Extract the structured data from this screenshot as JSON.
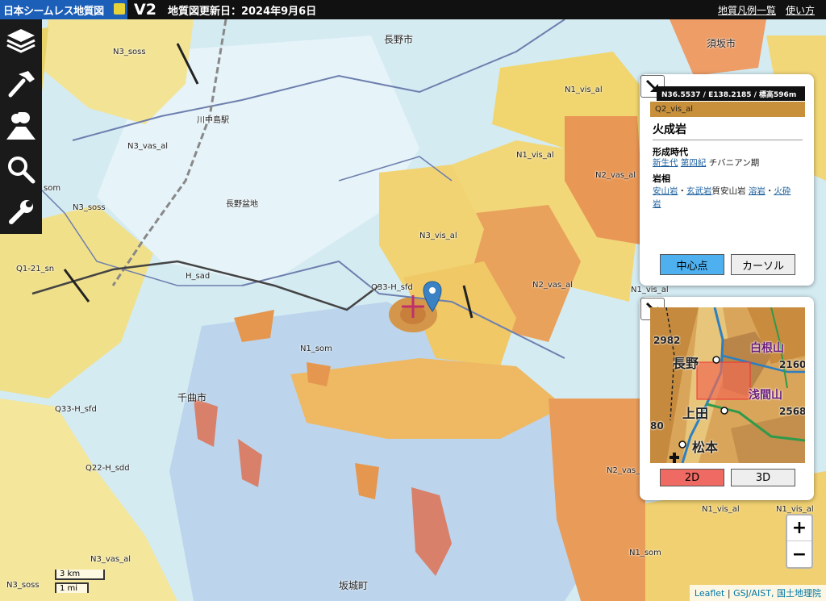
{
  "header": {
    "logo_text": "日本シームレス地質図",
    "version": "V2",
    "updated": "地質図更新日：2024年9月6日",
    "links": [
      "地質凡例一覧",
      "使い方"
    ]
  },
  "toolbar": {
    "tools": [
      {
        "icon": "layers-icon"
      },
      {
        "icon": "hammer-icon"
      },
      {
        "icon": "volcano-icon"
      },
      {
        "icon": "search-icon"
      },
      {
        "icon": "wrench-icon"
      }
    ]
  },
  "map": {
    "unit_labels": [
      "N3_soss",
      "N3_vas_al",
      "N3_soss",
      "Q1-21_sn",
      "H_sad",
      "Q33-H_sfd",
      "N3_vis_al",
      "N2_vas_al",
      "N1_vis_al",
      "N1_vis_al",
      "N2_vas_al",
      "N1_vis_al",
      "N1_som",
      "Q33-H_sfd",
      "Q22-H_sdd",
      "N3_vas_al",
      "N3_soss",
      "N1_som",
      "N2_vas_al",
      "N1_vis_al",
      "N1_vis_al",
      "som"
    ],
    "place_labels": [
      "長野市",
      "須坂市",
      "千曲市",
      "坂城町",
      "長野盆地",
      "川中島駅"
    ]
  },
  "info_panel": {
    "coords": "N36.5537 / E138.2185 / 標高596m",
    "unit_code": "Q2_vis_al",
    "rock_type": "火成岩",
    "formation_age_label": "形成時代",
    "formation_age_links": [
      "新生代",
      "第四紀"
    ],
    "formation_age_text": "チバニアン期",
    "lithology_label": "岩相",
    "lithology_link1": "安山岩",
    "lithology_sep1": "・",
    "lithology_link2": "玄武岩",
    "lithology_text1": "質安山岩",
    "lithology_link3": "溶岩",
    "lithology_sep2": "・",
    "lithology_link4": "火砕",
    "lithology_link5": "岩",
    "center_button": "中心点",
    "cursor_button": "カーソル"
  },
  "minimap": {
    "labels": {
      "nagano": "長野",
      "shiraneyama": "白根山",
      "asamayama": "浅間山",
      "ueda": "上田",
      "matsumoto": "松本",
      "h2982": "2982",
      "h2160": "2160",
      "h2568": "2568",
      "h80": "80"
    },
    "btn_2d": "2D",
    "btn_3d": "3D"
  },
  "zoom": {
    "in": "+",
    "out": "−"
  },
  "scale": {
    "km": "3 km",
    "mi": "1 mi"
  },
  "attribution": {
    "leaflet": "Leaflet",
    "sep": " | ",
    "gsj": "GSJ/AIST,",
    "gsi": " 国土地理院"
  }
}
